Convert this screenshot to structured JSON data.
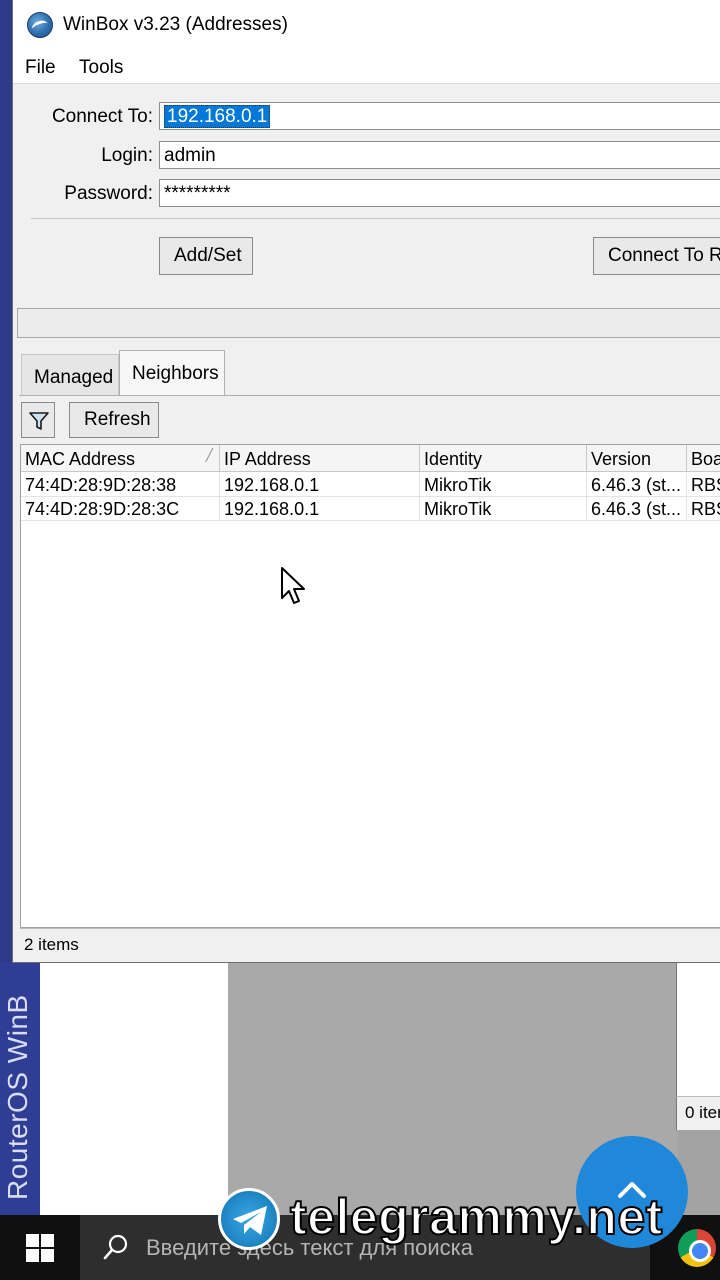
{
  "window": {
    "title": "WinBox v3.23 (Addresses)"
  },
  "menu": {
    "file": "File",
    "tools": "Tools"
  },
  "form": {
    "connect_to_label": "Connect To:",
    "connect_to_value": "192.168.0.1",
    "login_label": "Login:",
    "login_value": "admin",
    "password_label": "Password:",
    "password_value": "*********"
  },
  "buttons": {
    "add_set": "Add/Set",
    "connect_to_ro": "Connect To Ro",
    "refresh": "Refresh"
  },
  "tabs": [
    {
      "label": "Managed",
      "active": false
    },
    {
      "label": "Neighbors",
      "active": true
    }
  ],
  "table": {
    "columns": [
      "MAC Address",
      "IP Address",
      "Identity",
      "Version",
      "Boa"
    ],
    "rows": [
      [
        "74:4D:28:9D:28:38",
        "192.168.0.1",
        "MikroTik",
        "6.46.3 (st...",
        "RBS"
      ],
      [
        "74:4D:28:9D:28:3C",
        "192.168.0.1",
        "MikroTik",
        "6.46.3 (st...",
        "RBS"
      ]
    ]
  },
  "status": {
    "items_count": "2 items"
  },
  "background": {
    "side_text": "RouterOS WinB",
    "right_status": "0 iter"
  },
  "taskbar": {
    "search_placeholder": "Введите здесь текст для поиска"
  },
  "overlay": {
    "watermark": "telegrammy.net"
  },
  "colors": {
    "selection": "#0078d7",
    "taskbar": "#101010",
    "scroll_button": "#1f88d9"
  }
}
